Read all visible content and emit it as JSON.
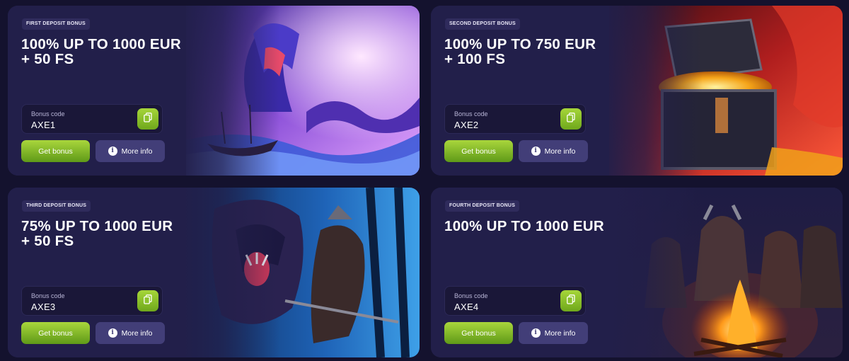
{
  "bonuses": [
    {
      "badge": "FIRST DEPOSIT BONUS",
      "title_line1": "100% UP TO 1000 EUR",
      "title_line2": "+ 50 FS",
      "code_label": "Bonus code",
      "code": "AXE1",
      "get_label": "Get bonus",
      "info_label": "More info",
      "art": "sea-serpent-attacking-viking-ship"
    },
    {
      "badge": "SECOND DEPOSIT BONUS",
      "title_line1": "100% UP TO 750 EUR",
      "title_line2": "+ 100 FS",
      "code_label": "Bonus code",
      "code": "AXE2",
      "get_label": "Get bonus",
      "info_label": "More info",
      "art": "treasure-chest-with-gold-in-cave"
    },
    {
      "badge": "THIRD DEPOSIT BONUS",
      "title_line1": "75% UP TO 1000 EUR",
      "title_line2": "+ 50 FS",
      "code_label": "Bonus code",
      "code": "AXE3",
      "get_label": "Get bonus",
      "info_label": "More info",
      "art": "bear-fighting-viking-warrior"
    },
    {
      "badge": "FOURTH DEPOSIT BONUS",
      "title_line1": "100% UP TO 1000 EUR",
      "title_line2": "",
      "code_label": "Bonus code",
      "code": "AXE4",
      "get_label": "Get bonus",
      "info_label": "More info",
      "art": "vikings-around-campfire"
    }
  ],
  "icons": {
    "copy": "copy-icon",
    "info": "info-icon",
    "info_glyph": "i"
  },
  "colors": {
    "background": "#14122e",
    "card": "#221f4a",
    "accent_green": "#8cc22c",
    "info_button": "#423e78"
  }
}
